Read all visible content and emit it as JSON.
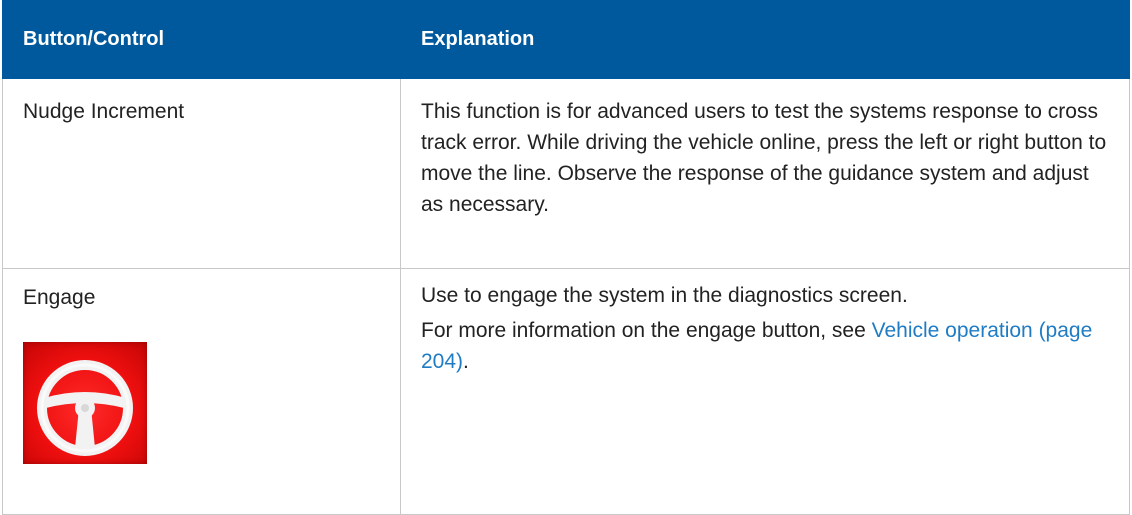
{
  "table": {
    "headers": {
      "control": "Button/Control",
      "explanation": "Explanation"
    },
    "rows": [
      {
        "control": "Nudge Increment",
        "explanation": "This function is for advanced users to test the systems response to cross track error. While driving the vehicle online, press the left or right button to move the line. Observe the response of the guidance system and adjust as necessary."
      },
      {
        "control": "Engage",
        "icon": "steering-wheel-icon",
        "explanation": "Use to engage the system in the diagnostics screen.",
        "more_info_prefix": "For more information on the engage button, see ",
        "link_text": "Vehicle operation (page 204)",
        "more_info_suffix": "."
      }
    ]
  },
  "colors": {
    "header_bg": "#00599c",
    "link": "#1f7cc4",
    "icon_bg": "#ee0f0f"
  }
}
